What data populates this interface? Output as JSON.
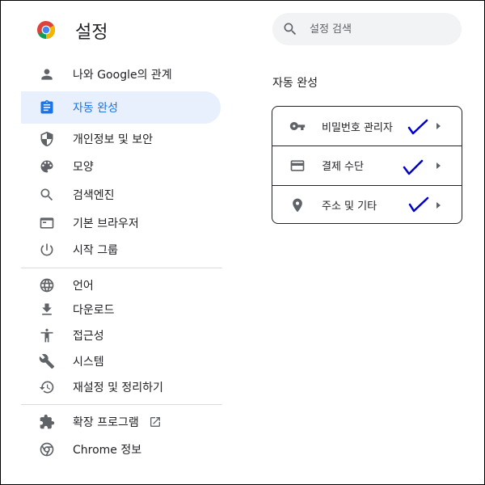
{
  "header": {
    "title": "설정",
    "logo_icon": "chrome-logo-icon"
  },
  "search": {
    "placeholder": "설정 검색",
    "value": ""
  },
  "sidebar": {
    "items": [
      {
        "label": "나와 Google의 관계",
        "icon": "person-icon"
      },
      {
        "label": "자동 완성",
        "icon": "clipboard-icon",
        "active": true
      },
      {
        "label": "개인정보 및 보안",
        "icon": "shield-icon"
      },
      {
        "label": "모양",
        "icon": "palette-icon"
      },
      {
        "label": "검색엔진",
        "icon": "search-icon"
      },
      {
        "label": "기본 브라우저",
        "icon": "browser-window-icon"
      },
      {
        "label": "시작 그룹",
        "icon": "power-icon"
      },
      {
        "label": "언어",
        "icon": "globe-icon"
      },
      {
        "label": "다운로드",
        "icon": "download-icon"
      },
      {
        "label": "접근성",
        "icon": "accessibility-icon"
      },
      {
        "label": "시스템",
        "icon": "wrench-icon"
      },
      {
        "label": "재설정 및 정리하기",
        "icon": "history-icon"
      },
      {
        "label": "확장 프로그램",
        "icon": "puzzle-icon",
        "external_icon": "open-in-new-icon"
      },
      {
        "label": "Chrome 정보",
        "icon": "chrome-icon"
      }
    ]
  },
  "main": {
    "section_title": "자동 완성",
    "rows": [
      {
        "label": "비밀번호 관리자",
        "icon": "key-icon",
        "checked": true
      },
      {
        "label": "결제 수단",
        "icon": "credit-card-icon",
        "checked": true
      },
      {
        "label": "주소 및 기타",
        "icon": "location-pin-icon",
        "checked": true
      }
    ]
  },
  "colors": {
    "accent": "#1a73e8",
    "active_bg": "#e8f0fe",
    "icon": "#5f6368",
    "text": "#202124",
    "check_mark": "#0000cc"
  }
}
